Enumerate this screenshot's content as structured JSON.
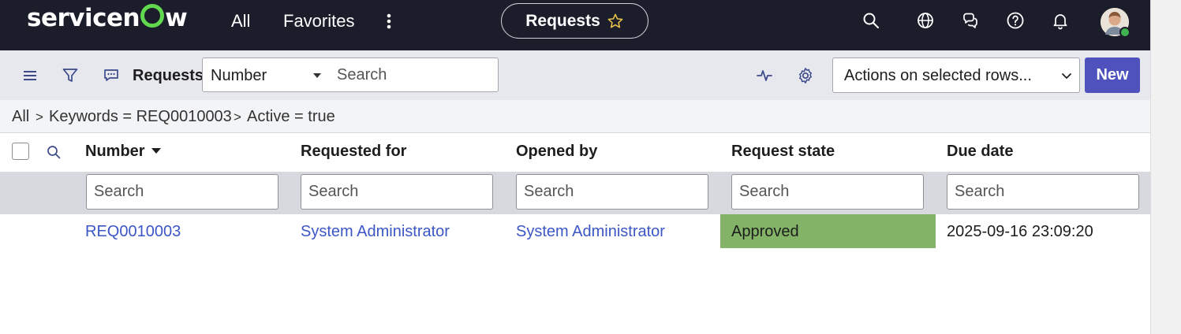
{
  "nav": {
    "brand": "servicenow",
    "all": "All",
    "favorites": "Favorites",
    "context_title": "Requests",
    "icons": [
      "search-icon",
      "globe-icon",
      "chat-icon",
      "help-icon",
      "bell-icon",
      "avatar"
    ]
  },
  "toolbar": {
    "title": "Requests",
    "field_select": "Number",
    "search_placeholder": "Search",
    "actions_select": "Actions on selected rows...",
    "new_label": "New"
  },
  "breadcrumb": {
    "all": "All",
    "sep": ">",
    "items": [
      "Keywords = REQ0010003",
      "Active = true"
    ]
  },
  "table": {
    "columns": [
      "Number",
      "Requested for",
      "Opened by",
      "Request state",
      "Due date"
    ],
    "search_placeholder": "Search",
    "rows": [
      {
        "number": "REQ0010003",
        "requested_for": "System Administrator",
        "opened_by": "System Administrator",
        "request_state": "Approved",
        "due_date": "2025-09-16 23:09:20"
      }
    ]
  },
  "colors": {
    "nav_bg": "#1c1d2b",
    "accent": "#4f52bd",
    "link": "#3c56c6",
    "approved": "#82b366",
    "brand_green": "#62d84e"
  }
}
